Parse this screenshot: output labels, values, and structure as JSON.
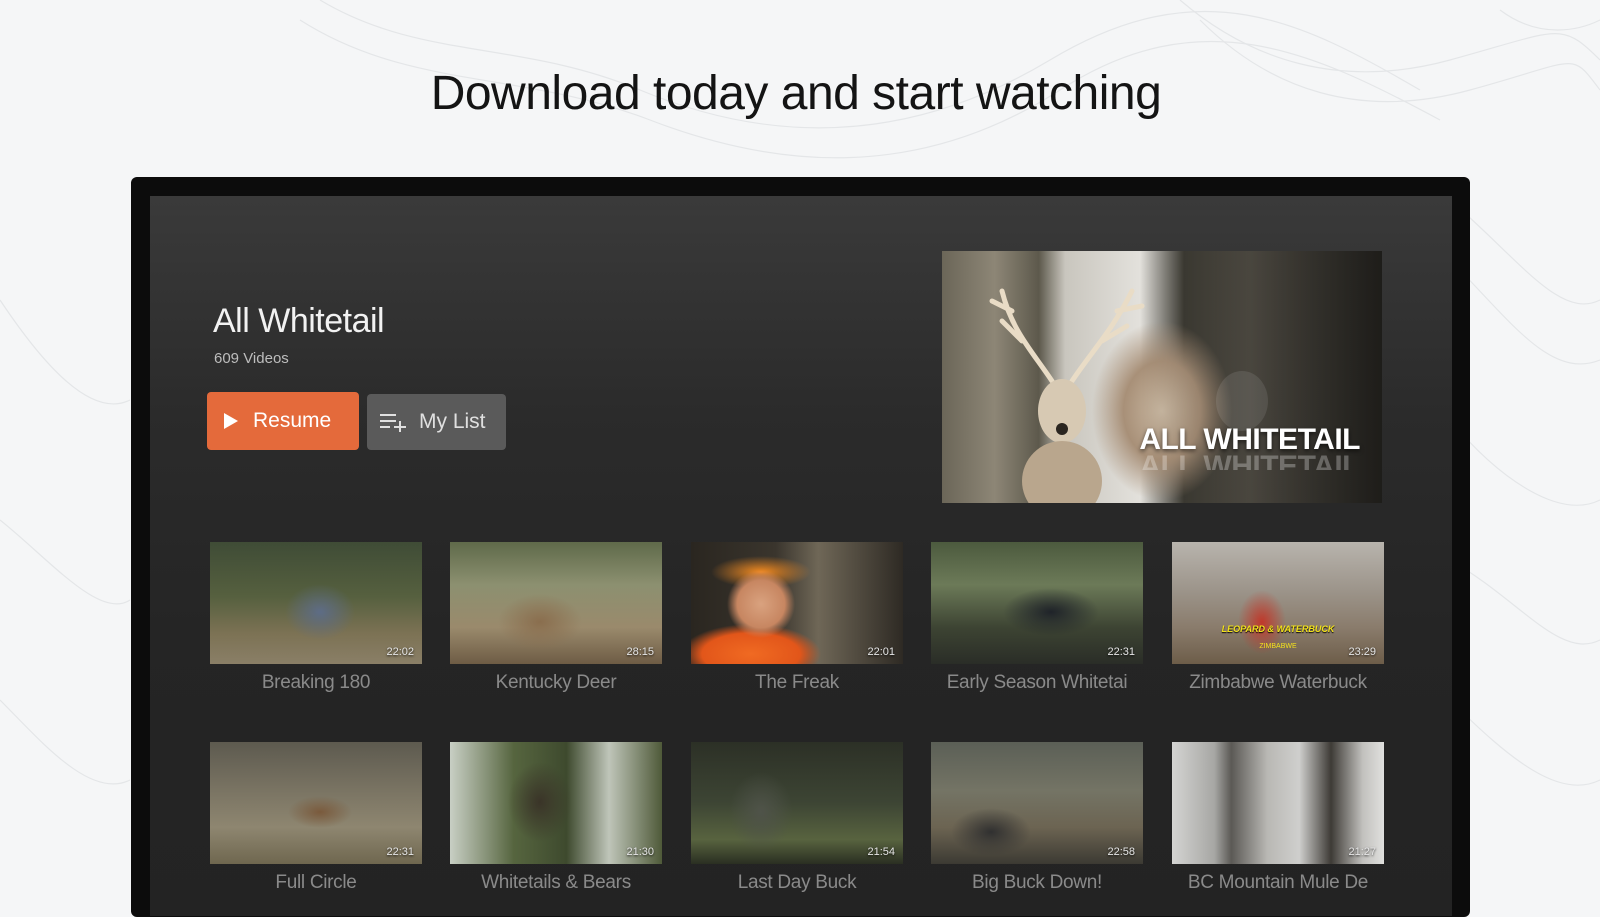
{
  "headline": "Download today and start watching",
  "show": {
    "title": "All Whitetail",
    "video_count": "609 Videos",
    "resume_label": "Resume",
    "mylist_label": "My List",
    "hero_title": "ALL WHITETAIL"
  },
  "videos_row1": [
    {
      "title": "Breaking 180",
      "duration": "22:02"
    },
    {
      "title": "Kentucky Deer",
      "duration": "28:15"
    },
    {
      "title": "The Freak",
      "duration": "22:01"
    },
    {
      "title": "Early Season Whitetai",
      "duration": "22:31"
    },
    {
      "title": "Zimbabwe Waterbuck",
      "duration": "23:29",
      "caption": "LEOPARD & WATERBUCK",
      "subcaption": "ZIMBABWE"
    }
  ],
  "videos_row2": [
    {
      "title": "Full Circle",
      "duration": "22:31"
    },
    {
      "title": "Whitetails & Bears",
      "duration": "21:30"
    },
    {
      "title": "Last Day Buck",
      "duration": "21:54"
    },
    {
      "title": "Big Buck Down!",
      "duration": "22:58"
    },
    {
      "title": "BC Mountain Mule De",
      "duration": "21:27"
    }
  ],
  "colors": {
    "accent": "#e46a3b",
    "secondary_button": "#5a5a5a",
    "screen_bg": "#2b2b2b",
    "page_bg": "#f5f6f7"
  }
}
